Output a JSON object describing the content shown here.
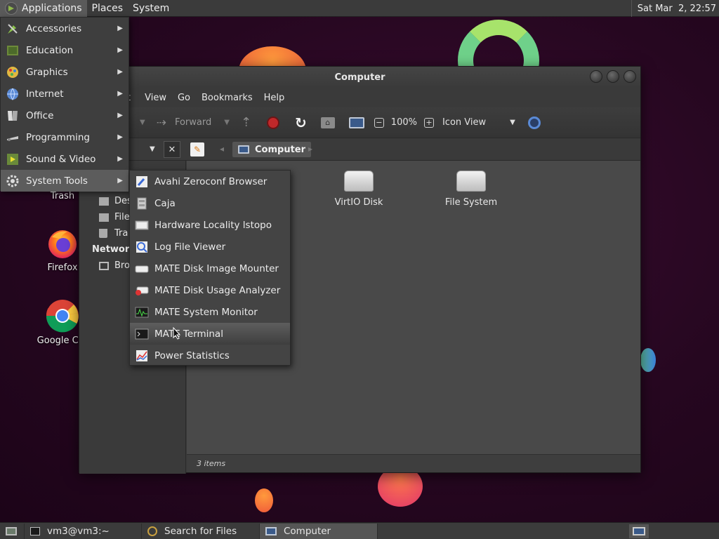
{
  "top_panel": {
    "menus": [
      "Applications",
      "Places",
      "System"
    ],
    "clock": "Sat Mar  2, 22:57"
  },
  "desktop": {
    "icons": [
      {
        "label": "Trash",
        "icon": "trash-icon"
      },
      {
        "label": "Firefox",
        "icon": "firefox-icon"
      },
      {
        "label": "Google Chr",
        "icon": "chrome-icon"
      }
    ]
  },
  "window": {
    "title": "Computer",
    "menubar": [
      "t",
      "View",
      "Go",
      "Bookmarks",
      "Help"
    ],
    "toolbar": {
      "forward_label": "Forward",
      "zoom": "100%",
      "view_mode": "Icon View"
    },
    "location": {
      "crumb": "Computer"
    },
    "sidebar": {
      "items": [
        "Des",
        "File",
        "Tra"
      ],
      "network_heading": "Network",
      "network_items": [
        "Bro"
      ]
    },
    "files": [
      {
        "label": "VirtIO Disk",
        "icon": "drive-icon"
      },
      {
        "label": "File System",
        "icon": "drive-icon"
      }
    ],
    "status": "3 items"
  },
  "apps_menu": {
    "items": [
      {
        "label": "Accessories",
        "icon": "accessories-icon"
      },
      {
        "label": "Education",
        "icon": "education-icon"
      },
      {
        "label": "Graphics",
        "icon": "graphics-icon"
      },
      {
        "label": "Internet",
        "icon": "internet-icon"
      },
      {
        "label": "Office",
        "icon": "office-icon"
      },
      {
        "label": "Programming",
        "icon": "programming-icon"
      },
      {
        "label": "Sound & Video",
        "icon": "sound-video-icon"
      },
      {
        "label": "System Tools",
        "icon": "system-tools-icon"
      }
    ],
    "active": "System Tools"
  },
  "system_tools_menu": {
    "items": [
      {
        "label": "Avahi Zeroconf Browser",
        "icon": "avahi-icon"
      },
      {
        "label": "Caja",
        "icon": "caja-icon"
      },
      {
        "label": "Hardware Locality lstopo",
        "icon": "hardware-icon"
      },
      {
        "label": "Log File Viewer",
        "icon": "log-viewer-icon"
      },
      {
        "label": "MATE Disk Image Mounter",
        "icon": "disk-mounter-icon"
      },
      {
        "label": "MATE Disk Usage Analyzer",
        "icon": "disk-usage-icon"
      },
      {
        "label": "MATE System Monitor",
        "icon": "system-monitor-icon"
      },
      {
        "label": "MATE Terminal",
        "icon": "terminal-icon"
      },
      {
        "label": "Power Statistics",
        "icon": "power-stats-icon"
      }
    ],
    "active": "MATE Terminal"
  },
  "bottom_panel": {
    "tasks": [
      {
        "label": "vm3@vm3:~",
        "icon": "terminal-icon"
      },
      {
        "label": "Search for Files",
        "icon": "search-icon"
      },
      {
        "label": "Computer",
        "icon": "computer-icon"
      }
    ]
  }
}
